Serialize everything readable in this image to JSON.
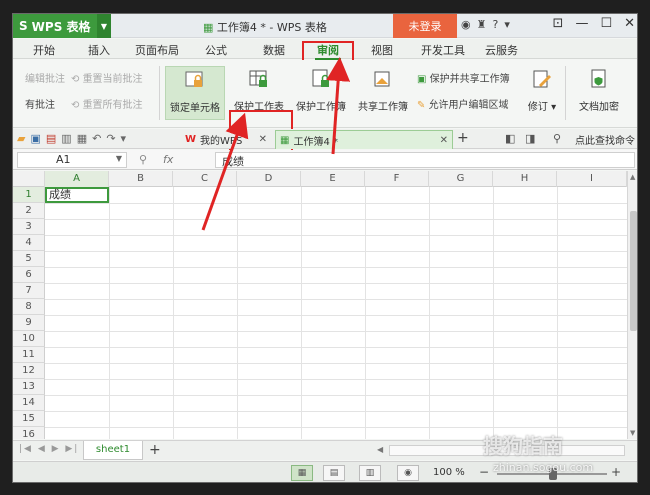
{
  "titlebar": {
    "app_name": "WPS 表格",
    "doc_title": "工作簿4 * - WPS 表格",
    "login": "未登录"
  },
  "menu": [
    {
      "label": "开始"
    },
    {
      "label": "插入"
    },
    {
      "label": "页面布局"
    },
    {
      "label": "公式"
    },
    {
      "label": "数据"
    },
    {
      "label": "审阅"
    },
    {
      "label": "视图"
    },
    {
      "label": "开发工具"
    },
    {
      "label": "云服务"
    }
  ],
  "ribbon": {
    "edit_comment": "编辑批注",
    "reset_current_comment": "重置当前批注",
    "delete_comment": "有批注",
    "reset_all_comments": "重置所有批注",
    "lock_cell": "锁定单元格",
    "protect_sheet": "保护工作表",
    "protect_workbook": "保护工作簿",
    "share_workbook": "共享工作簿",
    "protect_share": "保护并共享工作簿",
    "allow_edit_ranges": "允许用户编辑区域",
    "revise": "修订",
    "doc_encrypt": "文档加密"
  },
  "tabs": {
    "home_tab": "我的WPS",
    "doc_tab": "工作簿4 *",
    "find_cmd": "点此查找命令"
  },
  "formula": {
    "cell_ref": "A1",
    "fx": "fx",
    "content": "成绩"
  },
  "sheet": {
    "columns": [
      "A",
      "B",
      "C",
      "D",
      "E",
      "F",
      "G",
      "H",
      "I"
    ],
    "rows": [
      "1",
      "2",
      "3",
      "4",
      "5",
      "6",
      "7",
      "8",
      "9",
      "10",
      "11",
      "12",
      "13",
      "14",
      "15",
      "16"
    ],
    "a1_value": "成绩"
  },
  "sheettabs": {
    "sheet1": "sheet1"
  },
  "status": {
    "zoom": "100 %"
  },
  "watermark": {
    "brand": "搜狗指南",
    "url": "zhinan.sogou.com"
  },
  "colors": {
    "accent_green": "#3d9a3d",
    "login_orange": "#e9643e",
    "highlight_red": "#e02424"
  }
}
